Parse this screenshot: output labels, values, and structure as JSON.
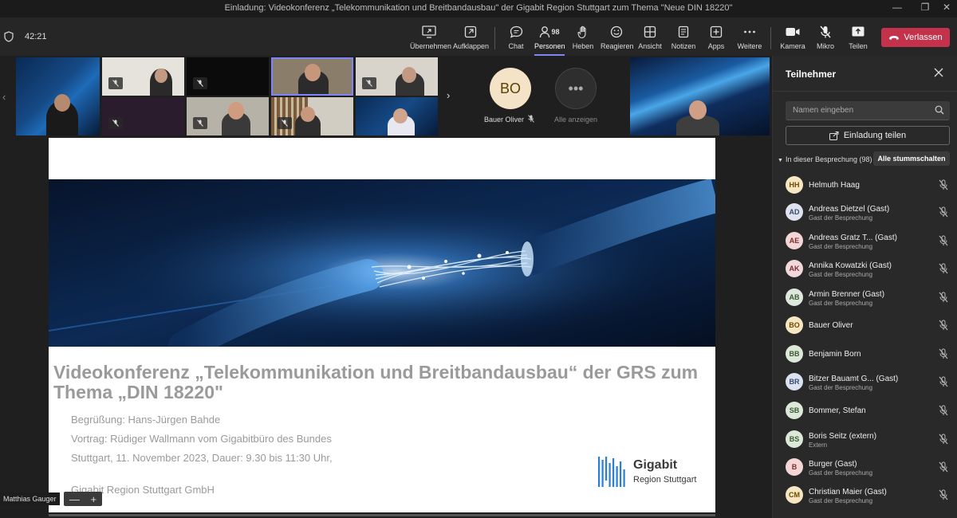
{
  "window": {
    "title": "Einladung: Videokonferenz „Telekommunikation und Breitbandausbau\" der Gigabit Region Stuttgart zum Thema \"Neue DIN 18220\"",
    "min": "—",
    "max": "❐",
    "close": "✕"
  },
  "toolbar": {
    "timer": "42:21",
    "buttons": [
      {
        "label": "Übernehmen",
        "icon": "share-screen-icon"
      },
      {
        "label": "Aufklappen",
        "icon": "pop-out-icon"
      },
      {
        "label": "Chat",
        "icon": "chat-icon"
      },
      {
        "label": "Personen",
        "icon": "people-icon",
        "count": "98",
        "active": true
      },
      {
        "label": "Heben",
        "icon": "raise-hand-icon"
      },
      {
        "label": "Reagieren",
        "icon": "smile-icon"
      },
      {
        "label": "Ansicht",
        "icon": "view-icon"
      },
      {
        "label": "Notizen",
        "icon": "notes-icon"
      },
      {
        "label": "Apps",
        "icon": "apps-icon"
      },
      {
        "label": "Weitere",
        "icon": "more-icon"
      },
      {
        "label": "Kamera",
        "icon": "camera-icon"
      },
      {
        "label": "Mikro",
        "icon": "mic-off-icon"
      },
      {
        "label": "Teilen",
        "icon": "share-icon"
      }
    ],
    "leave_label": "Verlassen"
  },
  "gallery": {
    "bauer_initials": "BO",
    "bauer_name": "Bauer Oliver",
    "more_label": "Alle anzeigen",
    "more_symbol": "•••"
  },
  "slide": {
    "title": "Videokonferenz „Telekommunikation und Breitbandausbau“ der GRS zum Thema „DIN 18220\"",
    "lines": [
      "Begrüßung: Hans-Jürgen Bahde",
      "Vortrag: Rüdiger Wallmann vom Gigabitbüro des Bundes",
      "Stuttgart, 11. November 2023, Dauer: 9.30 bis 11:30 Uhr,",
      "Gigabit Region Stuttgart GmbH"
    ],
    "logo_line1": "Gigabit",
    "logo_line2": "Region Stuttgart"
  },
  "presenter": {
    "name": "Matthias Gauger",
    "zoom_out": "—",
    "zoom_in": "+"
  },
  "panel": {
    "title": "Teilnehmer",
    "search_placeholder": "Namen eingeben",
    "invite_label": "Einladung teilen",
    "section_label": "In dieser Besprechung (98)",
    "mute_all_label": "Alle stummschalten",
    "participants": [
      {
        "initials": "HH",
        "name": "Helmuth Haag",
        "sub": "",
        "bg": "#f6e6c2",
        "fg": "#6b4d00"
      },
      {
        "initials": "AD",
        "name": "Andreas Dietzel (Gast)",
        "sub": "Gast der Besprechung",
        "bg": "#dfe3ee",
        "fg": "#3b4a6b"
      },
      {
        "initials": "AE",
        "name": "Andreas Gratz T...  (Gast)",
        "sub": "Gast der Besprechung",
        "bg": "#f5d6d6",
        "fg": "#7a2d2d"
      },
      {
        "initials": "AK",
        "name": "Annika Kowatzki (Gast)",
        "sub": "Gast der Besprechung",
        "bg": "#f2d8da",
        "fg": "#7a2d37"
      },
      {
        "initials": "AB",
        "name": "Armin Brenner (Gast)",
        "sub": "Gast der Besprechung",
        "bg": "#dfe8dc",
        "fg": "#3b5a33"
      },
      {
        "initials": "BO",
        "name": "Bauer Oliver",
        "sub": "",
        "bg": "#f6e6c2",
        "fg": "#6b4d00"
      },
      {
        "initials": "BB",
        "name": "Benjamin Born",
        "sub": "",
        "bg": "#dce8d8",
        "fg": "#3b5a33"
      },
      {
        "initials": "BR",
        "name": "Bitzer Bauamt G...  (Gast)",
        "sub": "Gast der Besprechung",
        "bg": "#dbe2f0",
        "fg": "#3b4a6b"
      },
      {
        "initials": "SB",
        "name": "Bommer, Stefan",
        "sub": "",
        "bg": "#dce8d8",
        "fg": "#3b5a33"
      },
      {
        "initials": "BS",
        "name": "Boris Seitz (extern)",
        "sub": "Extern",
        "bg": "#dce8d8",
        "fg": "#3b5a33"
      },
      {
        "initials": "B",
        "name": "Burger (Gast)",
        "sub": "Gast der Besprechung",
        "bg": "#f5d6d6",
        "fg": "#7a2d2d"
      },
      {
        "initials": "CM",
        "name": "Christian Maier (Gast)",
        "sub": "Gast der Besprechung",
        "bg": "#f6e6c2",
        "fg": "#6b4d00"
      }
    ]
  }
}
